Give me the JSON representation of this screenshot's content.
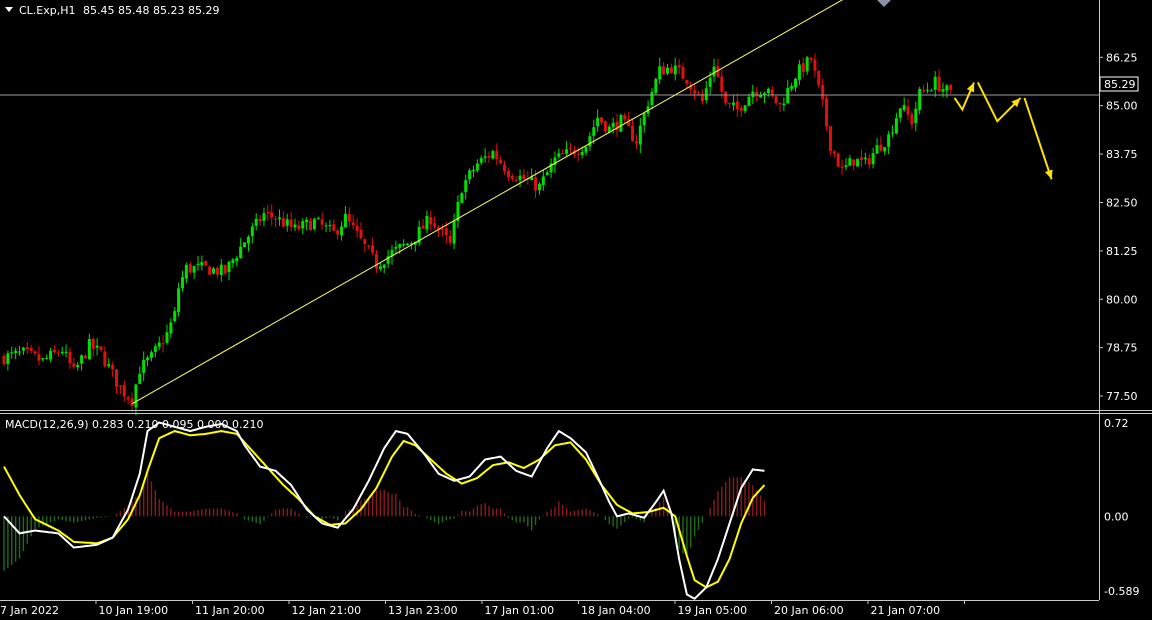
{
  "header": {
    "symbol": "CL.Exp,H1",
    "ohlc": "85.45 85.48 85.23 85.29"
  },
  "macd": {
    "label": "MACD(12,26,9) 0.283 0.210 0.095 0.000 0.210"
  },
  "colors": {
    "background": "#000000",
    "bull": "#00e000",
    "bear": "#e01010",
    "trendline": "#ffff66",
    "forecast": "#ffe000",
    "macd_line": "#ffffff",
    "signal_line": "#ffff00",
    "hist_pos": "#8b1a1a",
    "hist_neg": "#1f6b1f",
    "axis_text": "#ffffff",
    "frame": "#c8c8c8"
  },
  "chart_data": [
    {
      "type": "candlestick",
      "symbol": "CL.Exp",
      "timeframe": "H1",
      "last_price": "85.29",
      "y_ticks": [
        "86.25",
        "85.00",
        "83.75",
        "82.50",
        "81.25",
        "80.00",
        "78.75",
        "77.50"
      ],
      "ylim": [
        77.14,
        87.73
      ],
      "x_labels": [
        "7 Jan 2022",
        "10 Jan 19:00",
        "11 Jan 20:00",
        "12 Jan 21:00",
        "13 Jan 23:00",
        "17 Jan 01:00",
        "18 Jan 04:00",
        "19 Jan 05:00",
        "20 Jan 06:00",
        "21 Jan 07:00"
      ],
      "close_path": [
        [
          0,
          78.5
        ],
        [
          5,
          78.6
        ],
        [
          10,
          78.4
        ],
        [
          15,
          78.7
        ],
        [
          18,
          78.1
        ],
        [
          22,
          78.8
        ],
        [
          25,
          78.6
        ],
        [
          30,
          77.7
        ],
        [
          33,
          77.4
        ],
        [
          35,
          78.2
        ],
        [
          38,
          78.5
        ],
        [
          42,
          79.1
        ],
        [
          44,
          79.6
        ],
        [
          45,
          80.3
        ],
        [
          47,
          80.8
        ],
        [
          52,
          80.8
        ],
        [
          57,
          80.7
        ],
        [
          62,
          81.5
        ],
        [
          67,
          82.2
        ],
        [
          70,
          82.1
        ],
        [
          75,
          81.8
        ],
        [
          80,
          82.0
        ],
        [
          85,
          81.7
        ],
        [
          88,
          82.1
        ],
        [
          92,
          81.5
        ],
        [
          96,
          80.9
        ],
        [
          100,
          81.2
        ],
        [
          105,
          81.5
        ],
        [
          110,
          82.1
        ],
        [
          115,
          81.4
        ],
        [
          118,
          82.9
        ],
        [
          122,
          83.5
        ],
        [
          126,
          83.8
        ],
        [
          130,
          83.3
        ],
        [
          134,
          83.1
        ],
        [
          138,
          82.9
        ],
        [
          142,
          83.6
        ],
        [
          146,
          83.8
        ],
        [
          150,
          84.0
        ],
        [
          153,
          84.7
        ],
        [
          156,
          84.4
        ],
        [
          159,
          84.6
        ],
        [
          163,
          84.1
        ],
        [
          166,
          85.1
        ],
        [
          169,
          85.9
        ],
        [
          172,
          86.0
        ],
        [
          176,
          85.7
        ],
        [
          180,
          85.1
        ],
        [
          183,
          86.1
        ],
        [
          186,
          85.0
        ],
        [
          189,
          84.9
        ],
        [
          193,
          85.4
        ],
        [
          196,
          85.4
        ],
        [
          200,
          85.0
        ],
        [
          204,
          85.8
        ],
        [
          208,
          86.2
        ],
        [
          211,
          85.0
        ],
        [
          213,
          84.0
        ],
        [
          216,
          83.3
        ],
        [
          219,
          83.6
        ],
        [
          222,
          83.5
        ],
        [
          225,
          83.9
        ],
        [
          228,
          84.2
        ],
        [
          231,
          85.0
        ],
        [
          234,
          84.6
        ],
        [
          236,
          85.3
        ],
        [
          240,
          85.6
        ],
        [
          244,
          85.29
        ]
      ],
      "trendline": [
        [
          33,
          77.3
        ],
        [
          226,
          88.3
        ]
      ],
      "current_price_line": 85.29,
      "forecast_arrows": [
        [
          [
            245,
            85.2
          ],
          [
            247,
            84.9
          ],
          [
            250,
            85.6
          ]
        ],
        [
          [
            251,
            85.6
          ],
          [
            256,
            84.6
          ],
          [
            262,
            85.2
          ]
        ],
        [
          [
            263,
            85.2
          ],
          [
            270,
            83.1
          ]
        ]
      ]
    },
    {
      "type": "macd",
      "params": [
        12,
        26,
        9
      ],
      "y_ticks": [
        "0.72",
        "0.00",
        "-0.589"
      ],
      "ylim": [
        -0.589,
        0.72
      ],
      "macd_line": [
        [
          0,
          0.0
        ],
        [
          4,
          -0.12
        ],
        [
          8,
          -0.1
        ],
        [
          14,
          -0.12
        ],
        [
          18,
          -0.22
        ],
        [
          24,
          -0.2
        ],
        [
          28,
          -0.15
        ],
        [
          32,
          0.05
        ],
        [
          35,
          0.3
        ],
        [
          37,
          0.6
        ],
        [
          40,
          0.66
        ],
        [
          44,
          0.63
        ],
        [
          48,
          0.6
        ],
        [
          52,
          0.63
        ],
        [
          56,
          0.65
        ],
        [
          60,
          0.6
        ],
        [
          62,
          0.5
        ],
        [
          66,
          0.35
        ],
        [
          70,
          0.32
        ],
        [
          74,
          0.22
        ],
        [
          78,
          0.05
        ],
        [
          82,
          -0.05
        ],
        [
          86,
          -0.08
        ],
        [
          90,
          0.05
        ],
        [
          94,
          0.25
        ],
        [
          98,
          0.48
        ],
        [
          101,
          0.6
        ],
        [
          104,
          0.58
        ],
        [
          108,
          0.45
        ],
        [
          112,
          0.3
        ],
        [
          116,
          0.25
        ],
        [
          120,
          0.28
        ],
        [
          124,
          0.4
        ],
        [
          128,
          0.42
        ],
        [
          132,
          0.32
        ],
        [
          136,
          0.28
        ],
        [
          140,
          0.48
        ],
        [
          143,
          0.6
        ],
        [
          146,
          0.55
        ],
        [
          150,
          0.45
        ],
        [
          153,
          0.28
        ],
        [
          156,
          0.1
        ],
        [
          158,
          0.0
        ],
        [
          161,
          0.02
        ],
        [
          165,
          -0.01
        ],
        [
          168,
          0.1
        ],
        [
          170,
          0.18
        ],
        [
          172,
          0.02
        ],
        [
          174,
          -0.3
        ],
        [
          176,
          -0.55
        ],
        [
          178,
          -0.58
        ],
        [
          181,
          -0.5
        ],
        [
          184,
          -0.3
        ],
        [
          187,
          -0.05
        ],
        [
          190,
          0.2
        ],
        [
          193,
          0.33
        ],
        [
          196,
          0.32
        ]
      ],
      "signal_line": [
        [
          0,
          0.35
        ],
        [
          4,
          0.15
        ],
        [
          8,
          -0.02
        ],
        [
          14,
          -0.1
        ],
        [
          18,
          -0.18
        ],
        [
          24,
          -0.19
        ],
        [
          28,
          -0.15
        ],
        [
          32,
          -0.02
        ],
        [
          35,
          0.15
        ],
        [
          37,
          0.32
        ],
        [
          40,
          0.55
        ],
        [
          44,
          0.6
        ],
        [
          48,
          0.57
        ],
        [
          52,
          0.58
        ],
        [
          56,
          0.6
        ],
        [
          60,
          0.58
        ],
        [
          64,
          0.46
        ],
        [
          68,
          0.34
        ],
        [
          72,
          0.22
        ],
        [
          76,
          0.12
        ],
        [
          80,
          0.0
        ],
        [
          84,
          -0.06
        ],
        [
          88,
          -0.05
        ],
        [
          92,
          0.05
        ],
        [
          96,
          0.2
        ],
        [
          100,
          0.42
        ],
        [
          103,
          0.53
        ],
        [
          106,
          0.5
        ],
        [
          110,
          0.4
        ],
        [
          114,
          0.3
        ],
        [
          118,
          0.23
        ],
        [
          122,
          0.27
        ],
        [
          126,
          0.36
        ],
        [
          130,
          0.38
        ],
        [
          134,
          0.34
        ],
        [
          138,
          0.4
        ],
        [
          142,
          0.5
        ],
        [
          146,
          0.52
        ],
        [
          150,
          0.4
        ],
        [
          154,
          0.22
        ],
        [
          158,
          0.08
        ],
        [
          162,
          0.02
        ],
        [
          166,
          0.03
        ],
        [
          170,
          0.06
        ],
        [
          173,
          0.0
        ],
        [
          176,
          -0.28
        ],
        [
          178,
          -0.45
        ],
        [
          181,
          -0.5
        ],
        [
          184,
          -0.46
        ],
        [
          187,
          -0.3
        ],
        [
          190,
          -0.05
        ],
        [
          193,
          0.13
        ],
        [
          196,
          0.22
        ]
      ]
    }
  ]
}
